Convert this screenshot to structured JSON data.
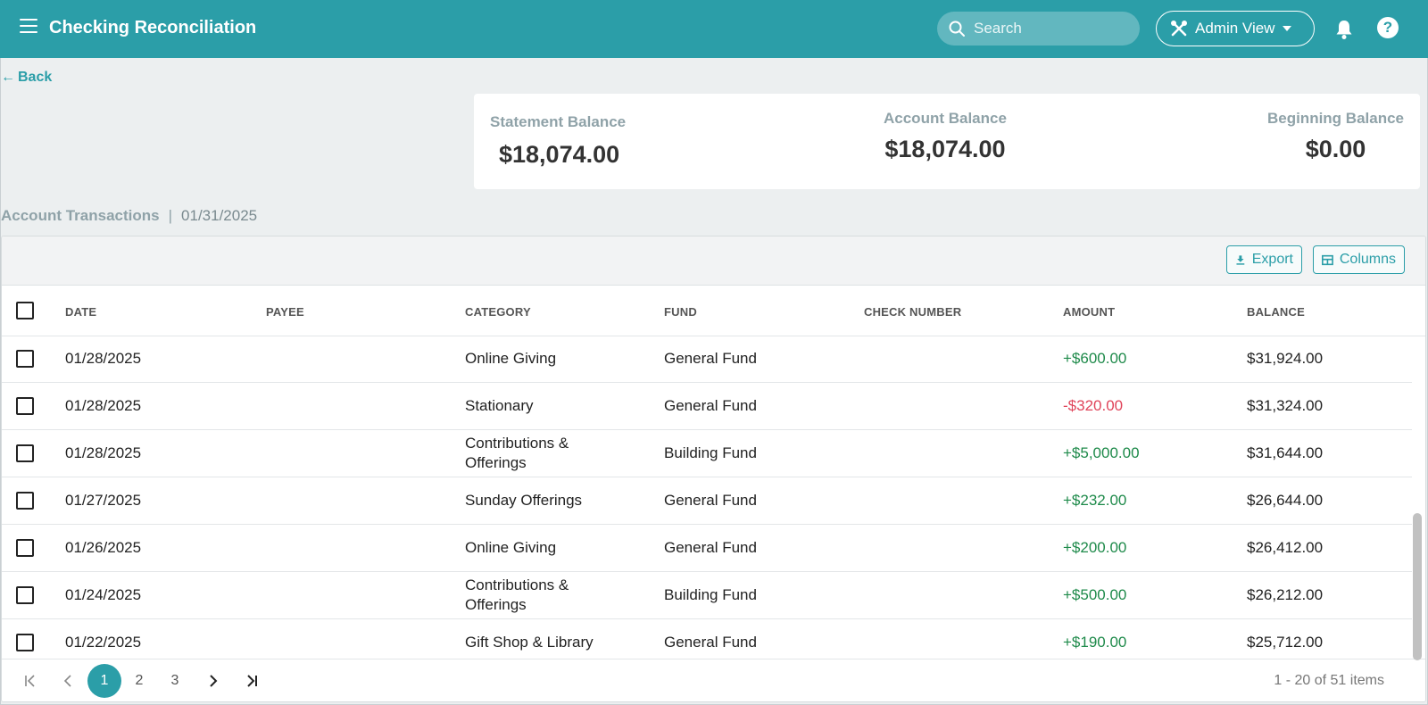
{
  "header": {
    "title": "Checking Reconciliation",
    "search_placeholder": "Search",
    "admin_label": "Admin View",
    "help_label": "?"
  },
  "nav": {
    "back_label": "Back"
  },
  "balances": {
    "statement": {
      "label": "Statement Balance",
      "value": "$18,074.00"
    },
    "account": {
      "label": "Account Balance",
      "value": "$18,074.00"
    },
    "beginning": {
      "label": "Beginning Balance",
      "value": "$0.00"
    }
  },
  "section": {
    "title": "Account Transactions",
    "separator": "|",
    "date": "01/31/2025"
  },
  "toolbar": {
    "export_label": "Export",
    "columns_label": "Columns"
  },
  "table": {
    "columns": [
      "DATE",
      "PAYEE",
      "CATEGORY",
      "FUND",
      "CHECK NUMBER",
      "AMOUNT",
      "BALANCE"
    ],
    "rows": [
      {
        "date": "01/28/2025",
        "payee": "",
        "category_lines": [
          "Online Giving"
        ],
        "fund": "General Fund",
        "check": "",
        "amount": "+$600.00",
        "sign": "pos",
        "balance": "$31,924.00"
      },
      {
        "date": "01/28/2025",
        "payee": "",
        "category_lines": [
          "Stationary"
        ],
        "fund": "General Fund",
        "check": "",
        "amount": "-$320.00",
        "sign": "neg",
        "balance": "$31,324.00"
      },
      {
        "date": "01/28/2025",
        "payee": "",
        "category_lines": [
          "Contributions &",
          "Offerings"
        ],
        "fund": "Building Fund",
        "check": "",
        "amount": "+$5,000.00",
        "sign": "pos",
        "balance": "$31,644.00"
      },
      {
        "date": "01/27/2025",
        "payee": "",
        "category_lines": [
          "Sunday Offerings"
        ],
        "fund": "General Fund",
        "check": "",
        "amount": "+$232.00",
        "sign": "pos",
        "balance": "$26,644.00"
      },
      {
        "date": "01/26/2025",
        "payee": "",
        "category_lines": [
          "Online Giving"
        ],
        "fund": "General Fund",
        "check": "",
        "amount": "+$200.00",
        "sign": "pos",
        "balance": "$26,412.00"
      },
      {
        "date": "01/24/2025",
        "payee": "",
        "category_lines": [
          "Contributions &",
          "Offerings"
        ],
        "fund": "Building Fund",
        "check": "",
        "amount": "+$500.00",
        "sign": "pos",
        "balance": "$26,212.00"
      },
      {
        "date": "01/22/2025",
        "payee": "",
        "category_lines": [
          "Gift Shop & Library"
        ],
        "fund": "General Fund",
        "check": "",
        "amount": "+$190.00",
        "sign": "pos",
        "balance": "$25,712.00"
      }
    ]
  },
  "pagination": {
    "pages": [
      "1",
      "2",
      "3"
    ],
    "current": "1",
    "info": "1 - 20 of 51 items"
  },
  "colors": {
    "brand": "#2b9ea8",
    "positive": "#1e8a4a",
    "negative": "#e0445a"
  }
}
